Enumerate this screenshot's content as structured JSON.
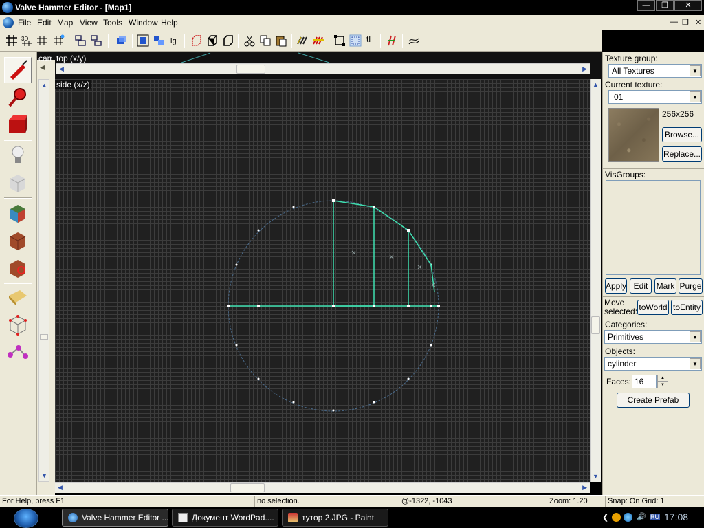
{
  "window": {
    "title": "Valve Hammer Editor - [Map1]"
  },
  "menu": {
    "items": [
      {
        "label": "File"
      },
      {
        "label": "Edit"
      },
      {
        "label": "Map"
      },
      {
        "label": "View"
      },
      {
        "label": "Tools"
      },
      {
        "label": "Window"
      },
      {
        "label": "Help"
      }
    ]
  },
  "toolbar": {
    "texture_lock_label": "tl"
  },
  "views": {
    "camera_label": "camera",
    "top_label": "top (x/y)",
    "side_label": "side (x/z)"
  },
  "panel": {
    "texture_group_label": "Texture group:",
    "texture_group_value": "All Textures",
    "current_texture_label": "Current texture:",
    "current_texture_value": "01",
    "texture_size": "256x256",
    "browse_label": "Browse...",
    "replace_label": "Replace...",
    "visgroups_label": "VisGroups:",
    "apply_label": "Apply",
    "edit_label": "Edit",
    "mark_label": "Mark",
    "purge_label": "Purge",
    "move_selected_label": "Move selected:",
    "to_world_label": "toWorld",
    "to_entity_label": "toEntity",
    "categories_label": "Categories:",
    "categories_value": "Primitives",
    "objects_label": "Objects:",
    "objects_value": "cylinder",
    "faces_label": "Faces:",
    "faces_value": "16",
    "create_prefab_label": "Create Prefab"
  },
  "status": {
    "help": "For Help, press F1",
    "selection": "no selection.",
    "coords": "@-1322, -1043",
    "zoom": "Zoom: 1.20",
    "snap": "Snap: On Grid: 1"
  },
  "taskbar": {
    "tasks": [
      {
        "label": "Valve Hammer Editor ..."
      },
      {
        "label": "Документ WordPad...."
      },
      {
        "label": "тутор 2.JPG - Paint"
      }
    ],
    "tray_lang": "RU",
    "clock": "17:08"
  },
  "colors": {
    "grid_bg": "#202020",
    "selection_line": "#3fe0b0",
    "prefab_outline": "#4a6a8a"
  }
}
